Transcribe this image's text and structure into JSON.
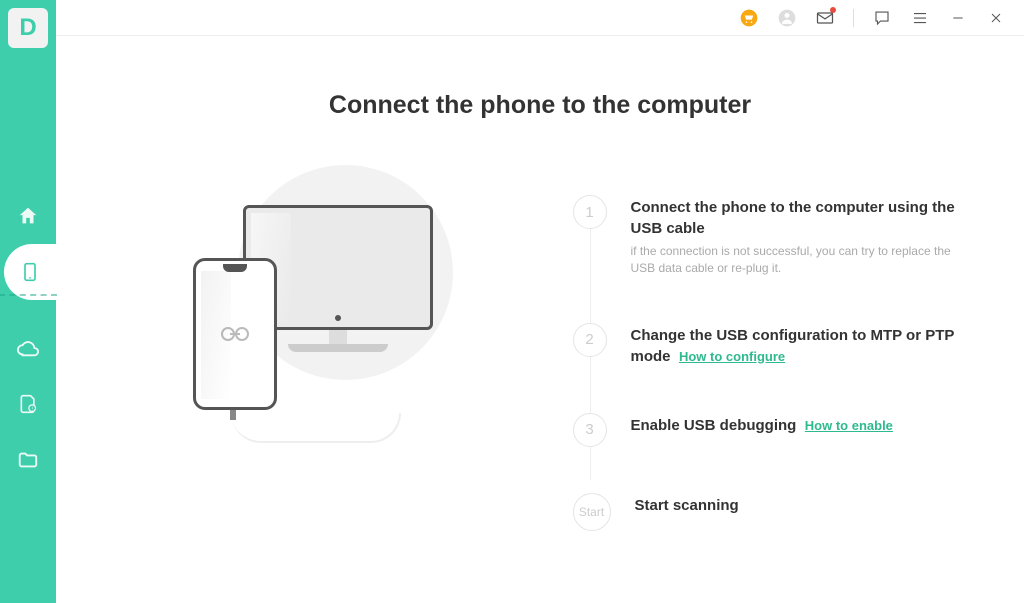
{
  "app": {
    "logo_letter": "D"
  },
  "header": {
    "title": "Connect the phone to the computer"
  },
  "steps": {
    "s1": {
      "num": "1",
      "title": "Connect the phone to the computer using the USB cable",
      "hint": "if the connection is not successful, you can try to replace the USB data cable or re-plug it."
    },
    "s2": {
      "num": "2",
      "title": "Change the USB configuration to MTP or PTP mode",
      "link": "How to configure"
    },
    "s3": {
      "num": "3",
      "title": "Enable USB debugging",
      "link": "How to enable"
    },
    "s4": {
      "num": "Start",
      "title": "Start scanning"
    }
  }
}
